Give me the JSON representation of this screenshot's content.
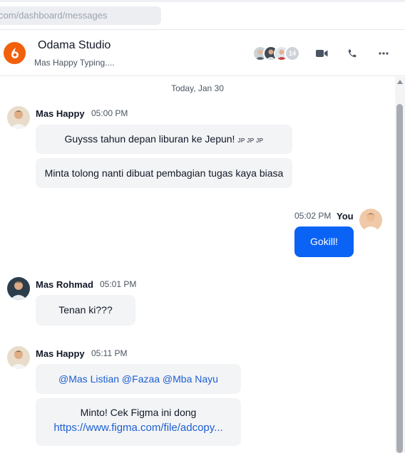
{
  "url_bar": {
    "text": "com/dashboard/messages"
  },
  "header": {
    "title": "Odama Studio",
    "status": "Mas Happy Typing....",
    "member_count": "14"
  },
  "chat": {
    "date_separator": "Today, Jan 30",
    "msg1": {
      "sender": "Mas Happy",
      "time": "05:00 PM",
      "text1": "Guysss tahun depan liburan ke Jepun!",
      "flags": "JP JP JP",
      "text2": "Minta tolong nanti dibuat pembagian tugas kaya biasa"
    },
    "msg2": {
      "sender": "You",
      "time": "05:02 PM",
      "text": "Gokill!"
    },
    "msg3": {
      "sender": "Mas Rohmad",
      "time": "05:01 PM",
      "text": "Tenan ki???"
    },
    "msg4": {
      "sender": "Mas Happy",
      "time": "05:11 PM",
      "mentions": "@Mas Listian @Fazaa @Mba Nayu",
      "text": "Minto! Cek Figma ini dong",
      "link": "https://www.figma.com/file/adcopy..."
    }
  },
  "colors": {
    "brand": "#f2600c",
    "my_bubble": "#0b63f6",
    "link": "#1d5fd1",
    "bubble": "#f3f4f6"
  },
  "icons": {
    "logo": "odama-logo-icon",
    "video": "video-camera-icon",
    "phone": "phone-icon",
    "more": "more-horizontal-icon"
  }
}
